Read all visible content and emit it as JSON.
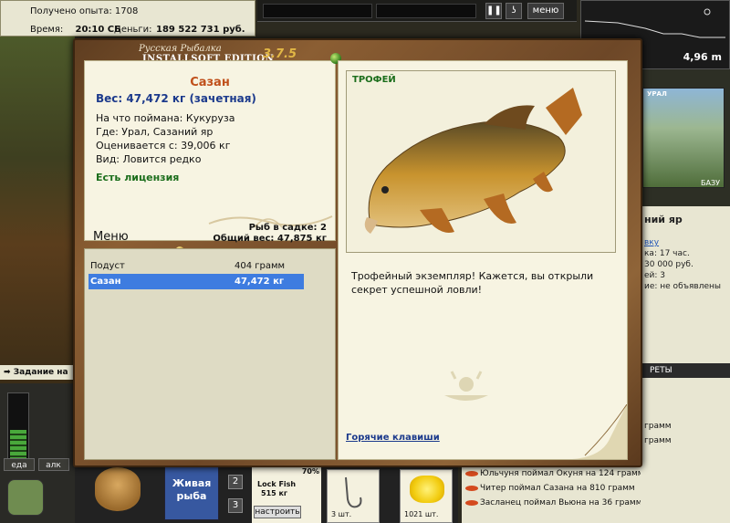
{
  "status": {
    "experience_label": "Получено опыта:",
    "experience_value": "1708",
    "time_label": "Время:",
    "time_value": "20:10 СБ",
    "money_label": "Деньги:",
    "money_value": "189 522 731 руб."
  },
  "toolbar": {
    "pause_icon": "pause-icon",
    "hook_icon": "hook-icon",
    "menu_label": "меню"
  },
  "depth": {
    "value": "4,96 m"
  },
  "right_panel": {
    "location_heading": "ний яр",
    "link": "вку",
    "line1": "ка: 17 час.",
    "line2": "30 000 руб.",
    "line3": "ей: 3",
    "line4": "ие: не объявлены",
    "tab_label": "РЕТЫ",
    "map_label": "УРАЛ",
    "base_label": "БАЗУ"
  },
  "task": {
    "label": "Задание на т"
  },
  "bait_tabs": {
    "food": "еда",
    "lure": "алк"
  },
  "bottom": {
    "live_fish_label": "Живая рыба",
    "slot_2": "2",
    "slot_3": "3",
    "lure_pct": "70%",
    "lure_name": "Lock Fish",
    "lure_weight": "515 кг",
    "setup_label": "настроить",
    "hook_count": "3 шт.",
    "corn_count": "1021 шт."
  },
  "news": [
    "Юльчуня поймал Окуня на 124 грамм",
    "Читер поймал Сазана на 810 грамм",
    "Засланец поймал Вьюна на 36 грамм"
  ],
  "news_right": [
    "грамм",
    "грамм"
  ],
  "modal": {
    "brand_title": "Русская Рыбалка",
    "brand_edition": "INSTALLSOFT EDITION",
    "brand_version": "3.7.5",
    "fish_name": "Сазан",
    "weight_line": "Вес: 47,472 кг (зачетная)",
    "caught_on": "На что поймана: Кукуруза",
    "location": "Где: Урал, Сазаний яр",
    "value": "Оценивается с: 39,006 кг",
    "kind": "Вид: Ловится редко",
    "license": "Есть лицензия",
    "menu_title": "Меню",
    "in_cage": "Рыб в садке: 2",
    "total_weight": "Общий вес: 47,875 кг",
    "list": [
      {
        "name": "Подуст",
        "weight": "404 грамм",
        "selected": false
      },
      {
        "name": "Сазан",
        "weight": "47,472 кг",
        "selected": true
      }
    ],
    "trophy_label": "ТРОФЕЙ",
    "trophy_text": "Трофейный экземпляр! Кажется, вы открыли секрет успешной ловли!",
    "hotkeys": "Горячие клавиши"
  },
  "colors": {
    "accent_name": "#c0501b",
    "weight_blue": "#1c3a8c",
    "license_green": "#1c6e1c",
    "selection_blue": "#3e7ce0"
  }
}
